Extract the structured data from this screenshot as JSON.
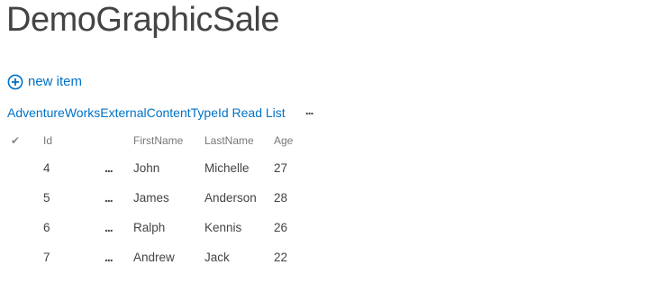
{
  "page": {
    "title": "DemoGraphicSale"
  },
  "toolbar": {
    "new_item_label": "new item",
    "new_item_icon": "plus-circle-icon"
  },
  "view": {
    "name": "AdventureWorksExternalContentTypeId Read List",
    "menu_label": "..."
  },
  "table": {
    "columns": [
      "Id",
      "FirstName",
      "LastName",
      "Age"
    ],
    "rows": [
      {
        "id": "4",
        "first": "John",
        "last": "Michelle",
        "age": "27"
      },
      {
        "id": "5",
        "first": "James",
        "last": "Anderson",
        "age": "28"
      },
      {
        "id": "6",
        "first": "Ralph",
        "last": "Kennis",
        "age": "26"
      },
      {
        "id": "7",
        "first": "Andrew",
        "last": "Jack",
        "age": "22"
      }
    ],
    "row_menu_label": "...",
    "select_all_icon": "checkmark-icon"
  },
  "colors": {
    "link": "#0072c6",
    "text": "#444444",
    "header": "#777777"
  }
}
